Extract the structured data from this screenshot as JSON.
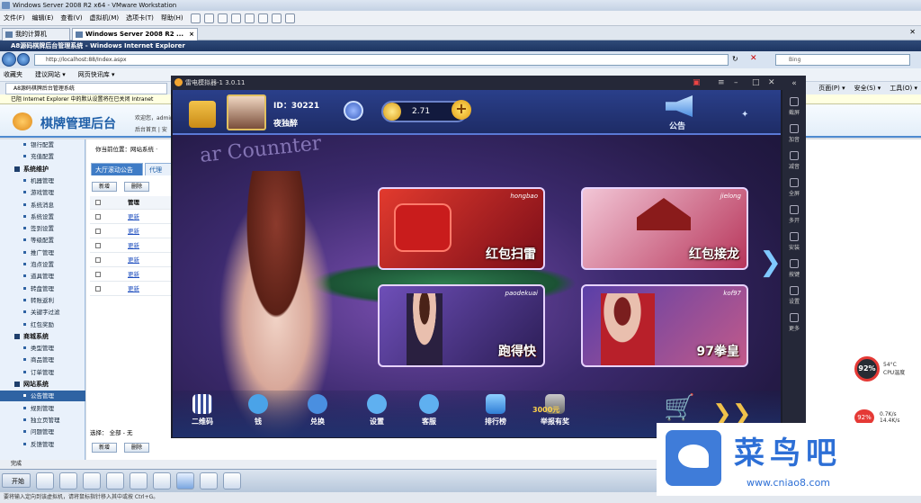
{
  "vm": {
    "title": "Windows Server 2008 R2 x64 - VMware Workstation",
    "menu": [
      "文件(F)",
      "编辑(E)",
      "查看(V)",
      "虚拟机(M)",
      "选项卡(T)",
      "帮助(H)"
    ],
    "tabs": [
      "我的计算机",
      "Windows Server 2008 R2 ..."
    ],
    "status": "要将输入定向到该虚拟机，请将鼠标指针移入其中或按 Ctrl+G。"
  },
  "ie": {
    "title": "A8源码棋牌后台管理系统 - Windows Internet Explorer",
    "address": "http://localhost:88/Index.aspx",
    "search_placeholder": "Bing",
    "favorites": [
      "收藏夹",
      "建议网站 ▾",
      "网页快讯库 ▾"
    ],
    "tab": "A8源码棋牌后台管理系统",
    "right_tools": [
      "页面(P) ▾",
      "安全(S) ▾",
      "工具(O) ▾"
    ],
    "infobar": "已阻 Internet Explorer 中的默认设置将在已关闭 Intranet",
    "status": "完成"
  },
  "admin": {
    "title": "棋牌管理后台",
    "welcome": "欢迎您，admin",
    "home": "后台首页 | 安",
    "breadcrumb": "你当前位置：网站系统 ·",
    "tabs": [
      "大厅滚动公告",
      "代理"
    ],
    "buttons": {
      "new": "新增",
      "delete": "删除"
    },
    "table_header": "管理",
    "rows": [
      "更新",
      "更新",
      "更新",
      "更新",
      "更新",
      "更新"
    ],
    "footer": "选择： 全部 - 无",
    "sidebar": [
      {
        "label": "银行配置",
        "type": "item"
      },
      {
        "label": "充值配置",
        "type": "item"
      },
      {
        "label": "系统维护",
        "type": "group"
      },
      {
        "label": "机器管理",
        "type": "item"
      },
      {
        "label": "游戏管理",
        "type": "item"
      },
      {
        "label": "系统消息",
        "type": "item"
      },
      {
        "label": "系统设置",
        "type": "item"
      },
      {
        "label": "签到设置",
        "type": "item"
      },
      {
        "label": "等级配置",
        "type": "item"
      },
      {
        "label": "推广管理",
        "type": "item"
      },
      {
        "label": "泡点设置",
        "type": "item"
      },
      {
        "label": "道具管理",
        "type": "item"
      },
      {
        "label": "转盘管理",
        "type": "item"
      },
      {
        "label": "转账返利",
        "type": "item"
      },
      {
        "label": "关键字过滤",
        "type": "item"
      },
      {
        "label": "红包奖励",
        "type": "item"
      },
      {
        "label": "商城系统",
        "type": "group"
      },
      {
        "label": "类型管理",
        "type": "item"
      },
      {
        "label": "商品管理",
        "type": "item"
      },
      {
        "label": "订单管理",
        "type": "item"
      },
      {
        "label": "网站系统",
        "type": "group"
      },
      {
        "label": "公告管理",
        "type": "selected"
      },
      {
        "label": "规则管理",
        "type": "item"
      },
      {
        "label": "独立页管理",
        "type": "item"
      },
      {
        "label": "问题管理",
        "type": "item"
      },
      {
        "label": "反馈管理",
        "type": "item"
      }
    ]
  },
  "emulator": {
    "title": "雷电模拟器-1 3.0.11",
    "side": [
      "截屏",
      "加音",
      "减音",
      "全屏",
      "多开",
      "安装",
      "按键",
      "设置",
      "更多"
    ]
  },
  "game": {
    "id_label": "ID：30221",
    "nickname": "夜独醉",
    "coins": "2.71",
    "notice": "公告",
    "bg_sign": "ar Counnter",
    "rooms": [
      {
        "label": "红包扫雷",
        "tag": "hongbao"
      },
      {
        "label": "红包接龙",
        "tag": "jielong"
      },
      {
        "label": "跑得快",
        "tag": "paodekuai"
      },
      {
        "label": "97拳皇",
        "tag": "kof97"
      }
    ],
    "bottom_nav": [
      "二维码",
      "钱",
      "兑换",
      "设置",
      "客服",
      "排行榜",
      "举报有奖"
    ],
    "report_badge": "3000元"
  },
  "widgets": {
    "cpu1": "92%",
    "cpu1_text": "54°C CPU温度",
    "cpu2": "92%",
    "cpu2_text": "0.7K/s 14.4K/s"
  },
  "watermark": {
    "text": "菜鸟吧",
    "url": "www.cniao8.com"
  },
  "taskbar": {
    "start": "开始"
  },
  "colors": {
    "admin_blue": "#2f63a3",
    "game_gold": "#f4b22c",
    "cpu_red": "#e53935",
    "watermark_blue": "#2d6fd6"
  }
}
